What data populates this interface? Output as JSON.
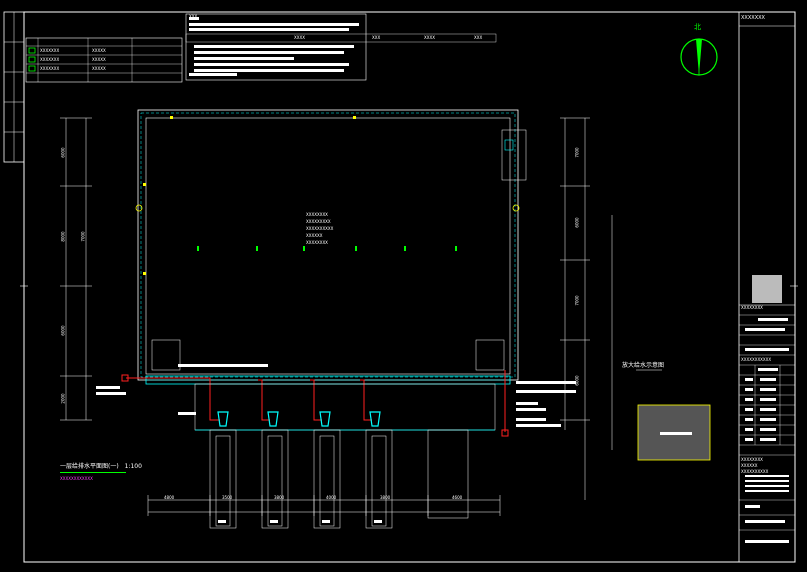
{
  "north_label": "北",
  "title_block": {
    "header": "XXXXXXX",
    "project_lines": [
      "XXXXXXXX",
      "XXXXXX",
      "XXXXXXXXXX",
      "XXXXXXXXXXXX"
    ],
    "drawing_name_1": "XXXXXXXXXXX",
    "drawing_name_2": "XXXXXXXX"
  },
  "legend": {
    "rows": [
      {
        "symbol": "",
        "name": "XXXXXXX",
        "note": "XXXXX"
      },
      {
        "symbol": "",
        "name": "XXXXXXX",
        "note": "XXXXX"
      },
      {
        "symbol": "",
        "name": "XXXXXXX",
        "note": "XXXXX"
      }
    ]
  },
  "notes": {
    "title": "XXX",
    "header_cols": [
      "XXXX",
      "XXX",
      "XXXX",
      "XXX",
      "XXX"
    ]
  },
  "plan": {
    "room_label_lines": [
      "XXXXXXXX",
      "XXXXXXXXX",
      "XXXXXXXXXX",
      "XXXXXX",
      "XXXXXXXX"
    ],
    "caption": "一层给排水平面图(一)",
    "scale": "1:100",
    "sub_caption": "XXXXXXXXXXXX",
    "detail_label": "放大给水示意图",
    "dim_bottom": [
      "4800",
      "3500",
      "3800",
      "4000",
      "3800",
      "4600"
    ],
    "dim_left": [
      "6000",
      "8000",
      "6000",
      "7000",
      "2000"
    ],
    "dim_right": [
      "7000",
      "6000",
      "7000",
      "6000"
    ]
  }
}
